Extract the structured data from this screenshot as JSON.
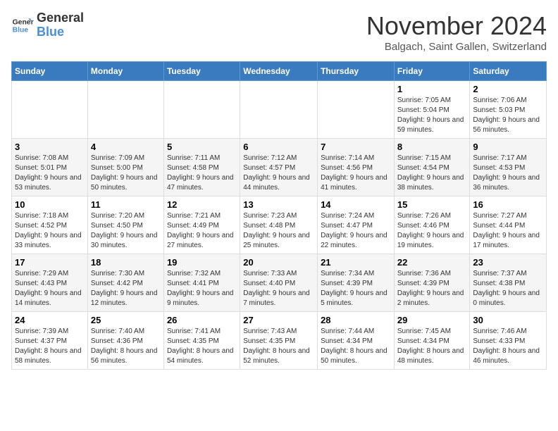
{
  "logo": {
    "line1": "General",
    "line2": "Blue"
  },
  "title": "November 2024",
  "subtitle": "Balgach, Saint Gallen, Switzerland",
  "weekdays": [
    "Sunday",
    "Monday",
    "Tuesday",
    "Wednesday",
    "Thursday",
    "Friday",
    "Saturday"
  ],
  "weeks": [
    [
      {
        "day": "",
        "info": ""
      },
      {
        "day": "",
        "info": ""
      },
      {
        "day": "",
        "info": ""
      },
      {
        "day": "",
        "info": ""
      },
      {
        "day": "",
        "info": ""
      },
      {
        "day": "1",
        "info": "Sunrise: 7:05 AM\nSunset: 5:04 PM\nDaylight: 9 hours and 59 minutes."
      },
      {
        "day": "2",
        "info": "Sunrise: 7:06 AM\nSunset: 5:03 PM\nDaylight: 9 hours and 56 minutes."
      }
    ],
    [
      {
        "day": "3",
        "info": "Sunrise: 7:08 AM\nSunset: 5:01 PM\nDaylight: 9 hours and 53 minutes."
      },
      {
        "day": "4",
        "info": "Sunrise: 7:09 AM\nSunset: 5:00 PM\nDaylight: 9 hours and 50 minutes."
      },
      {
        "day": "5",
        "info": "Sunrise: 7:11 AM\nSunset: 4:58 PM\nDaylight: 9 hours and 47 minutes."
      },
      {
        "day": "6",
        "info": "Sunrise: 7:12 AM\nSunset: 4:57 PM\nDaylight: 9 hours and 44 minutes."
      },
      {
        "day": "7",
        "info": "Sunrise: 7:14 AM\nSunset: 4:56 PM\nDaylight: 9 hours and 41 minutes."
      },
      {
        "day": "8",
        "info": "Sunrise: 7:15 AM\nSunset: 4:54 PM\nDaylight: 9 hours and 38 minutes."
      },
      {
        "day": "9",
        "info": "Sunrise: 7:17 AM\nSunset: 4:53 PM\nDaylight: 9 hours and 36 minutes."
      }
    ],
    [
      {
        "day": "10",
        "info": "Sunrise: 7:18 AM\nSunset: 4:52 PM\nDaylight: 9 hours and 33 minutes."
      },
      {
        "day": "11",
        "info": "Sunrise: 7:20 AM\nSunset: 4:50 PM\nDaylight: 9 hours and 30 minutes."
      },
      {
        "day": "12",
        "info": "Sunrise: 7:21 AM\nSunset: 4:49 PM\nDaylight: 9 hours and 27 minutes."
      },
      {
        "day": "13",
        "info": "Sunrise: 7:23 AM\nSunset: 4:48 PM\nDaylight: 9 hours and 25 minutes."
      },
      {
        "day": "14",
        "info": "Sunrise: 7:24 AM\nSunset: 4:47 PM\nDaylight: 9 hours and 22 minutes."
      },
      {
        "day": "15",
        "info": "Sunrise: 7:26 AM\nSunset: 4:46 PM\nDaylight: 9 hours and 19 minutes."
      },
      {
        "day": "16",
        "info": "Sunrise: 7:27 AM\nSunset: 4:44 PM\nDaylight: 9 hours and 17 minutes."
      }
    ],
    [
      {
        "day": "17",
        "info": "Sunrise: 7:29 AM\nSunset: 4:43 PM\nDaylight: 9 hours and 14 minutes."
      },
      {
        "day": "18",
        "info": "Sunrise: 7:30 AM\nSunset: 4:42 PM\nDaylight: 9 hours and 12 minutes."
      },
      {
        "day": "19",
        "info": "Sunrise: 7:32 AM\nSunset: 4:41 PM\nDaylight: 9 hours and 9 minutes."
      },
      {
        "day": "20",
        "info": "Sunrise: 7:33 AM\nSunset: 4:40 PM\nDaylight: 9 hours and 7 minutes."
      },
      {
        "day": "21",
        "info": "Sunrise: 7:34 AM\nSunset: 4:39 PM\nDaylight: 9 hours and 5 minutes."
      },
      {
        "day": "22",
        "info": "Sunrise: 7:36 AM\nSunset: 4:39 PM\nDaylight: 9 hours and 2 minutes."
      },
      {
        "day": "23",
        "info": "Sunrise: 7:37 AM\nSunset: 4:38 PM\nDaylight: 9 hours and 0 minutes."
      }
    ],
    [
      {
        "day": "24",
        "info": "Sunrise: 7:39 AM\nSunset: 4:37 PM\nDaylight: 8 hours and 58 minutes."
      },
      {
        "day": "25",
        "info": "Sunrise: 7:40 AM\nSunset: 4:36 PM\nDaylight: 8 hours and 56 minutes."
      },
      {
        "day": "26",
        "info": "Sunrise: 7:41 AM\nSunset: 4:35 PM\nDaylight: 8 hours and 54 minutes."
      },
      {
        "day": "27",
        "info": "Sunrise: 7:43 AM\nSunset: 4:35 PM\nDaylight: 8 hours and 52 minutes."
      },
      {
        "day": "28",
        "info": "Sunrise: 7:44 AM\nSunset: 4:34 PM\nDaylight: 8 hours and 50 minutes."
      },
      {
        "day": "29",
        "info": "Sunrise: 7:45 AM\nSunset: 4:34 PM\nDaylight: 8 hours and 48 minutes."
      },
      {
        "day": "30",
        "info": "Sunrise: 7:46 AM\nSunset: 4:33 PM\nDaylight: 8 hours and 46 minutes."
      }
    ]
  ]
}
